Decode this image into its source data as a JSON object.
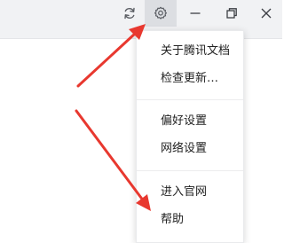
{
  "titlebar": {
    "buttons": [
      {
        "name": "refresh-icon"
      },
      {
        "name": "gear-icon"
      },
      {
        "name": "minimize-icon"
      },
      {
        "name": "restore-icon"
      },
      {
        "name": "close-icon"
      }
    ]
  },
  "menu": {
    "items": [
      {
        "label": "关于腾讯文档"
      },
      {
        "label": "检查更新…"
      },
      {
        "label": "偏好设置"
      },
      {
        "label": "网络设置"
      },
      {
        "label": "进入官网"
      },
      {
        "label": "帮助"
      }
    ]
  },
  "colors": {
    "annotation_arrow": "#e8382f",
    "titlebar_bg": "#f1f2f4",
    "settings_hover_bg": "#dcdee2"
  }
}
